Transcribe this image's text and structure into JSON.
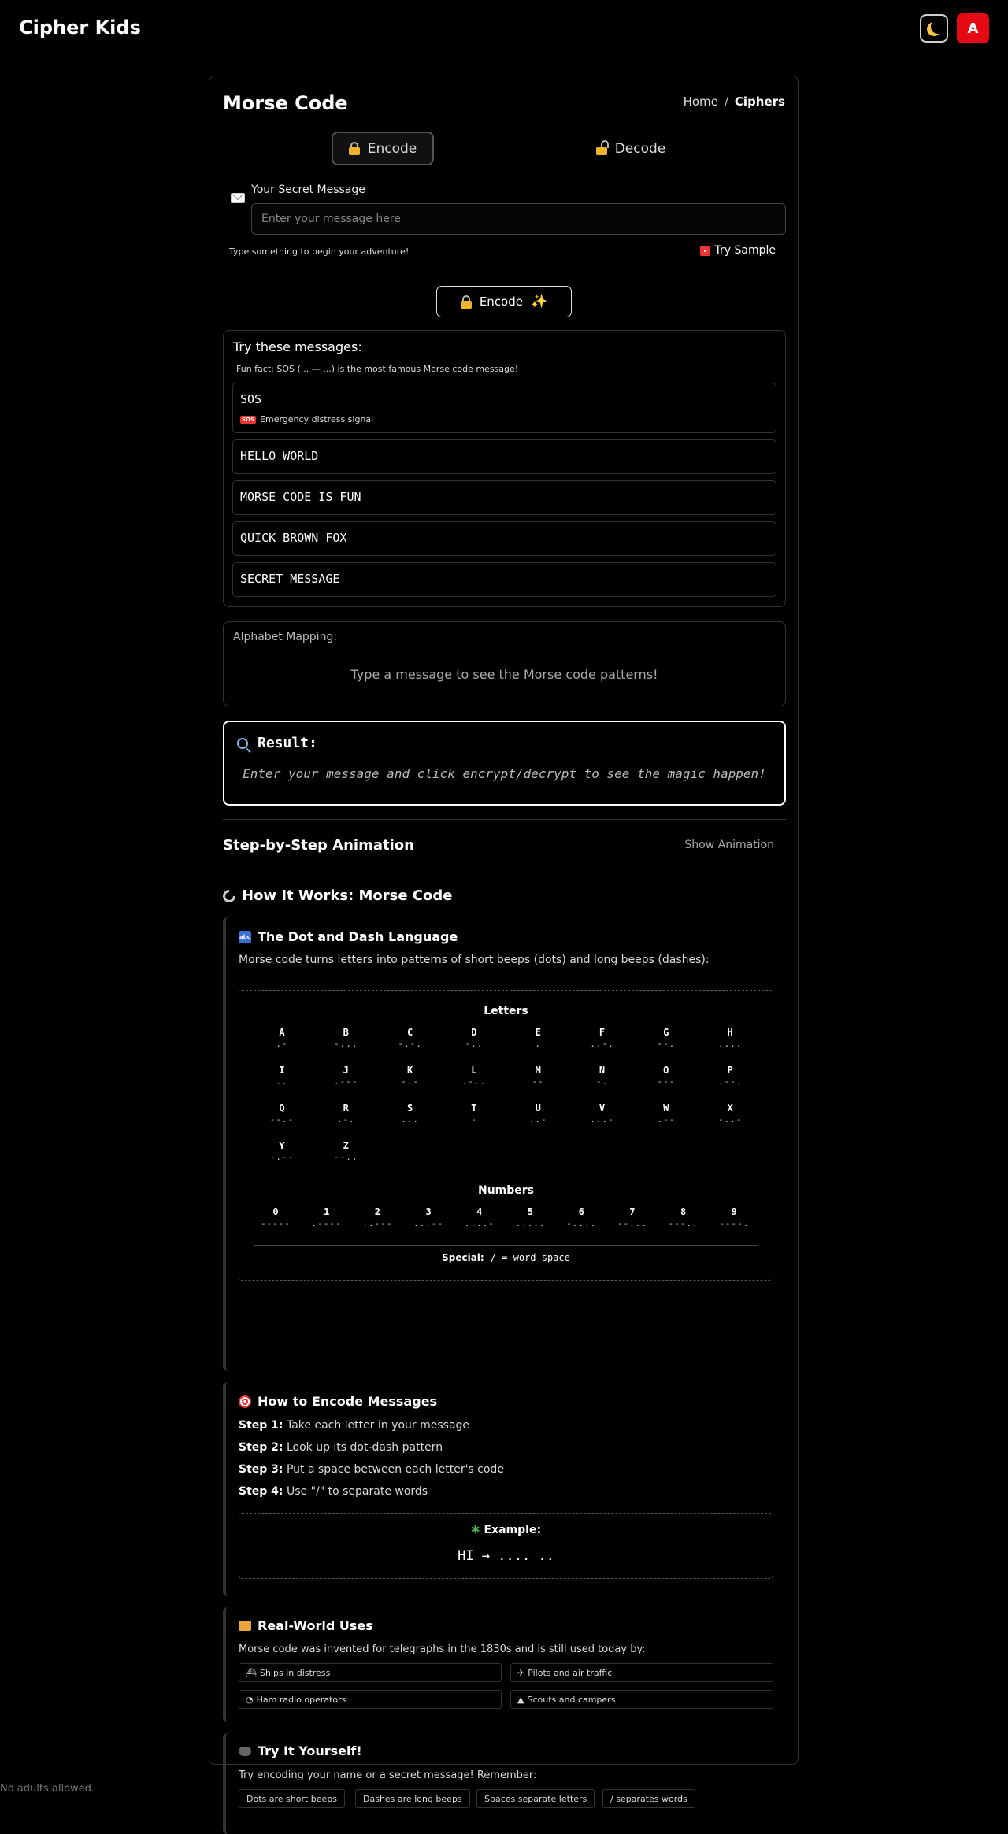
{
  "app": {
    "brand": "Cipher Kids",
    "avatar_initial": "A"
  },
  "page": {
    "title": "Morse Code",
    "breadcrumb": {
      "home": "Home",
      "separator": "/",
      "current": "Ciphers"
    }
  },
  "tabs": [
    {
      "label": "Encode",
      "active": true
    },
    {
      "label": "Decode",
      "active": false
    }
  ],
  "input": {
    "label": "Your Secret Message",
    "placeholder": "Enter your message here",
    "value": "",
    "hint": "Type something to begin your adventure!",
    "try_sample": "Try Sample"
  },
  "encode_button": "Encode",
  "suggestions": {
    "title": "Try these messages:",
    "fun_fact": "Fun fact:  SOS (... — ...) is the most famous Morse code message!",
    "items": [
      {
        "text": "SOS",
        "note_badge": "SOS",
        "note": "Emergency distress signal"
      },
      {
        "text": "HELLO WORLD"
      },
      {
        "text": "MORSE CODE IS FUN"
      },
      {
        "text": "QUICK BROWN FOX"
      },
      {
        "text": "SECRET MESSAGE"
      }
    ]
  },
  "mapping": {
    "label": "Alphabet Mapping:",
    "empty": "Type a message to see the Morse code patterns!"
  },
  "result": {
    "title": "Result:",
    "placeholder": "Enter your message and click encrypt/decrypt to see the magic happen!"
  },
  "animation": {
    "title": "Step-by-Step Animation",
    "toggle": "Show Animation"
  },
  "how": {
    "title": "How It Works: Morse Code",
    "dot_dash": {
      "icon_text": "abc",
      "title": "The Dot and Dash Language",
      "text": "Morse code turns letters into patterns of short beeps (dots) and long beeps (dashes):",
      "letters_title": "Letters",
      "letters": [
        [
          "A",
          ".-"
        ],
        [
          "B",
          "-..."
        ],
        [
          "C",
          "-.-."
        ],
        [
          "D",
          "-.."
        ],
        [
          "E",
          "."
        ],
        [
          "F",
          "..-."
        ],
        [
          "G",
          "--."
        ],
        [
          "H",
          "...."
        ],
        [
          "I",
          ".."
        ],
        [
          "J",
          ".---"
        ],
        [
          "K",
          "-.-"
        ],
        [
          "L",
          ".-.."
        ],
        [
          "M",
          "--"
        ],
        [
          "N",
          "-."
        ],
        [
          "O",
          "---"
        ],
        [
          "P",
          ".--."
        ],
        [
          "Q",
          "--.-"
        ],
        [
          "R",
          ".-."
        ],
        [
          "S",
          "..."
        ],
        [
          "T",
          "-"
        ],
        [
          "U",
          "..-"
        ],
        [
          "V",
          "...-"
        ],
        [
          "W",
          ".--"
        ],
        [
          "X",
          "-..-"
        ],
        [
          "Y",
          "-.--"
        ],
        [
          "Z",
          "--.."
        ]
      ],
      "numbers_title": "Numbers",
      "numbers": [
        [
          "0",
          "-----"
        ],
        [
          "1",
          ".----"
        ],
        [
          "2",
          "..---"
        ],
        [
          "3",
          "...--"
        ],
        [
          "4",
          "....-"
        ],
        [
          "5",
          "....."
        ],
        [
          "6",
          "-...."
        ],
        [
          "7",
          "--..."
        ],
        [
          "8",
          "---.."
        ],
        [
          "9",
          "----."
        ]
      ],
      "special_label": "Special:",
      "special_value": "/ = word space"
    },
    "encode": {
      "title": "How to Encode Messages",
      "steps": [
        {
          "label": "Step 1:",
          "text": "Take each letter in your message"
        },
        {
          "label": "Step 2:",
          "text": "Look up its dot-dash pattern"
        },
        {
          "label": "Step 3:",
          "text": "Put a space between each letter's code"
        },
        {
          "label": "Step 4:",
          "text": "Use \"/\" to separate words"
        }
      ],
      "example_title": "Example:",
      "example_value": "HI  →  .... .."
    },
    "uses": {
      "title": "Real-World Uses",
      "text": "Morse code was invented for telegraphs in the 1830s and is still used today by:",
      "items": [
        "Ships in distress",
        "Pilots and air traffic",
        "Ham radio operators",
        "Scouts and campers"
      ]
    },
    "try": {
      "title": "Try It Yourself!",
      "text": "Try encoding your name or a secret message! Remember:",
      "tips": [
        "Dots are short beeps",
        "Dashes are long beeps",
        "Spaces separate letters",
        "/ separates words"
      ]
    }
  },
  "footer": "No adults allowed.",
  "colors": {
    "accent_red": "#e50914",
    "background": "#000000",
    "border": "#333333"
  }
}
